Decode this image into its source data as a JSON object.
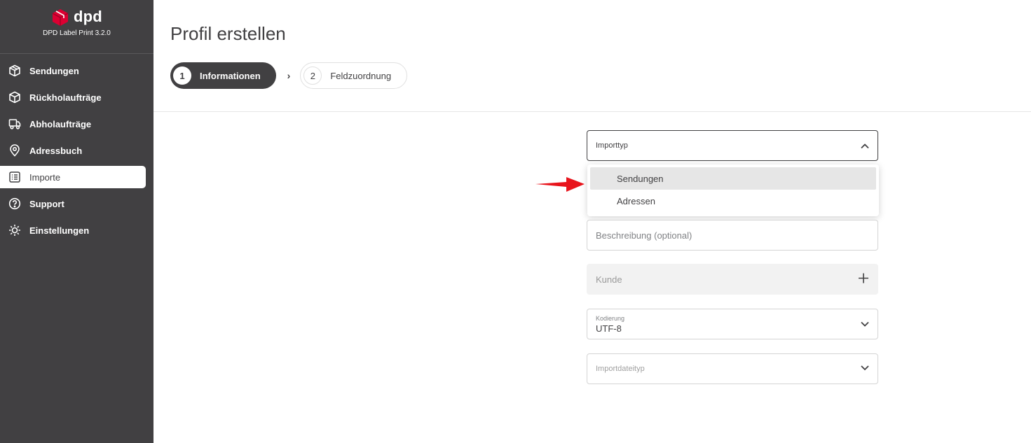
{
  "app": {
    "brand_name": "dpd",
    "version": "DPD Label Print 3.2.0"
  },
  "sidebar": {
    "items": [
      {
        "label": "Sendungen",
        "icon": "package-icon"
      },
      {
        "label": "Rückholaufträge",
        "icon": "box-icon"
      },
      {
        "label": "Abholaufträge",
        "icon": "truck-icon"
      },
      {
        "label": "Adressbuch",
        "icon": "location-pin-icon"
      },
      {
        "label": "Importe",
        "icon": "list-icon",
        "active": true
      },
      {
        "label": "Support",
        "icon": "help-icon"
      },
      {
        "label": "Einstellungen",
        "icon": "gear-icon"
      }
    ]
  },
  "page": {
    "title": "Profil erstellen"
  },
  "stepper": {
    "steps": [
      {
        "number": "1",
        "label": "Informationen",
        "active": true
      },
      {
        "number": "2",
        "label": "Feldzuordnung",
        "active": false
      }
    ],
    "separator": "›"
  },
  "form": {
    "importtyp": {
      "label": "Importtyp",
      "open": true,
      "options": [
        "Sendungen",
        "Adressen"
      ],
      "highlighted": "Sendungen"
    },
    "beschreibung": {
      "placeholder": "Beschreibung (optional)"
    },
    "kunde": {
      "placeholder": "Kunde"
    },
    "kodierung": {
      "label": "Kodierung",
      "value": "UTF-8"
    },
    "importdateityp": {
      "placeholder": "Importdateityp"
    }
  },
  "colors": {
    "sidebar_bg": "#414042",
    "brand_red": "#dc0032",
    "arrow_red": "#e8141c"
  }
}
